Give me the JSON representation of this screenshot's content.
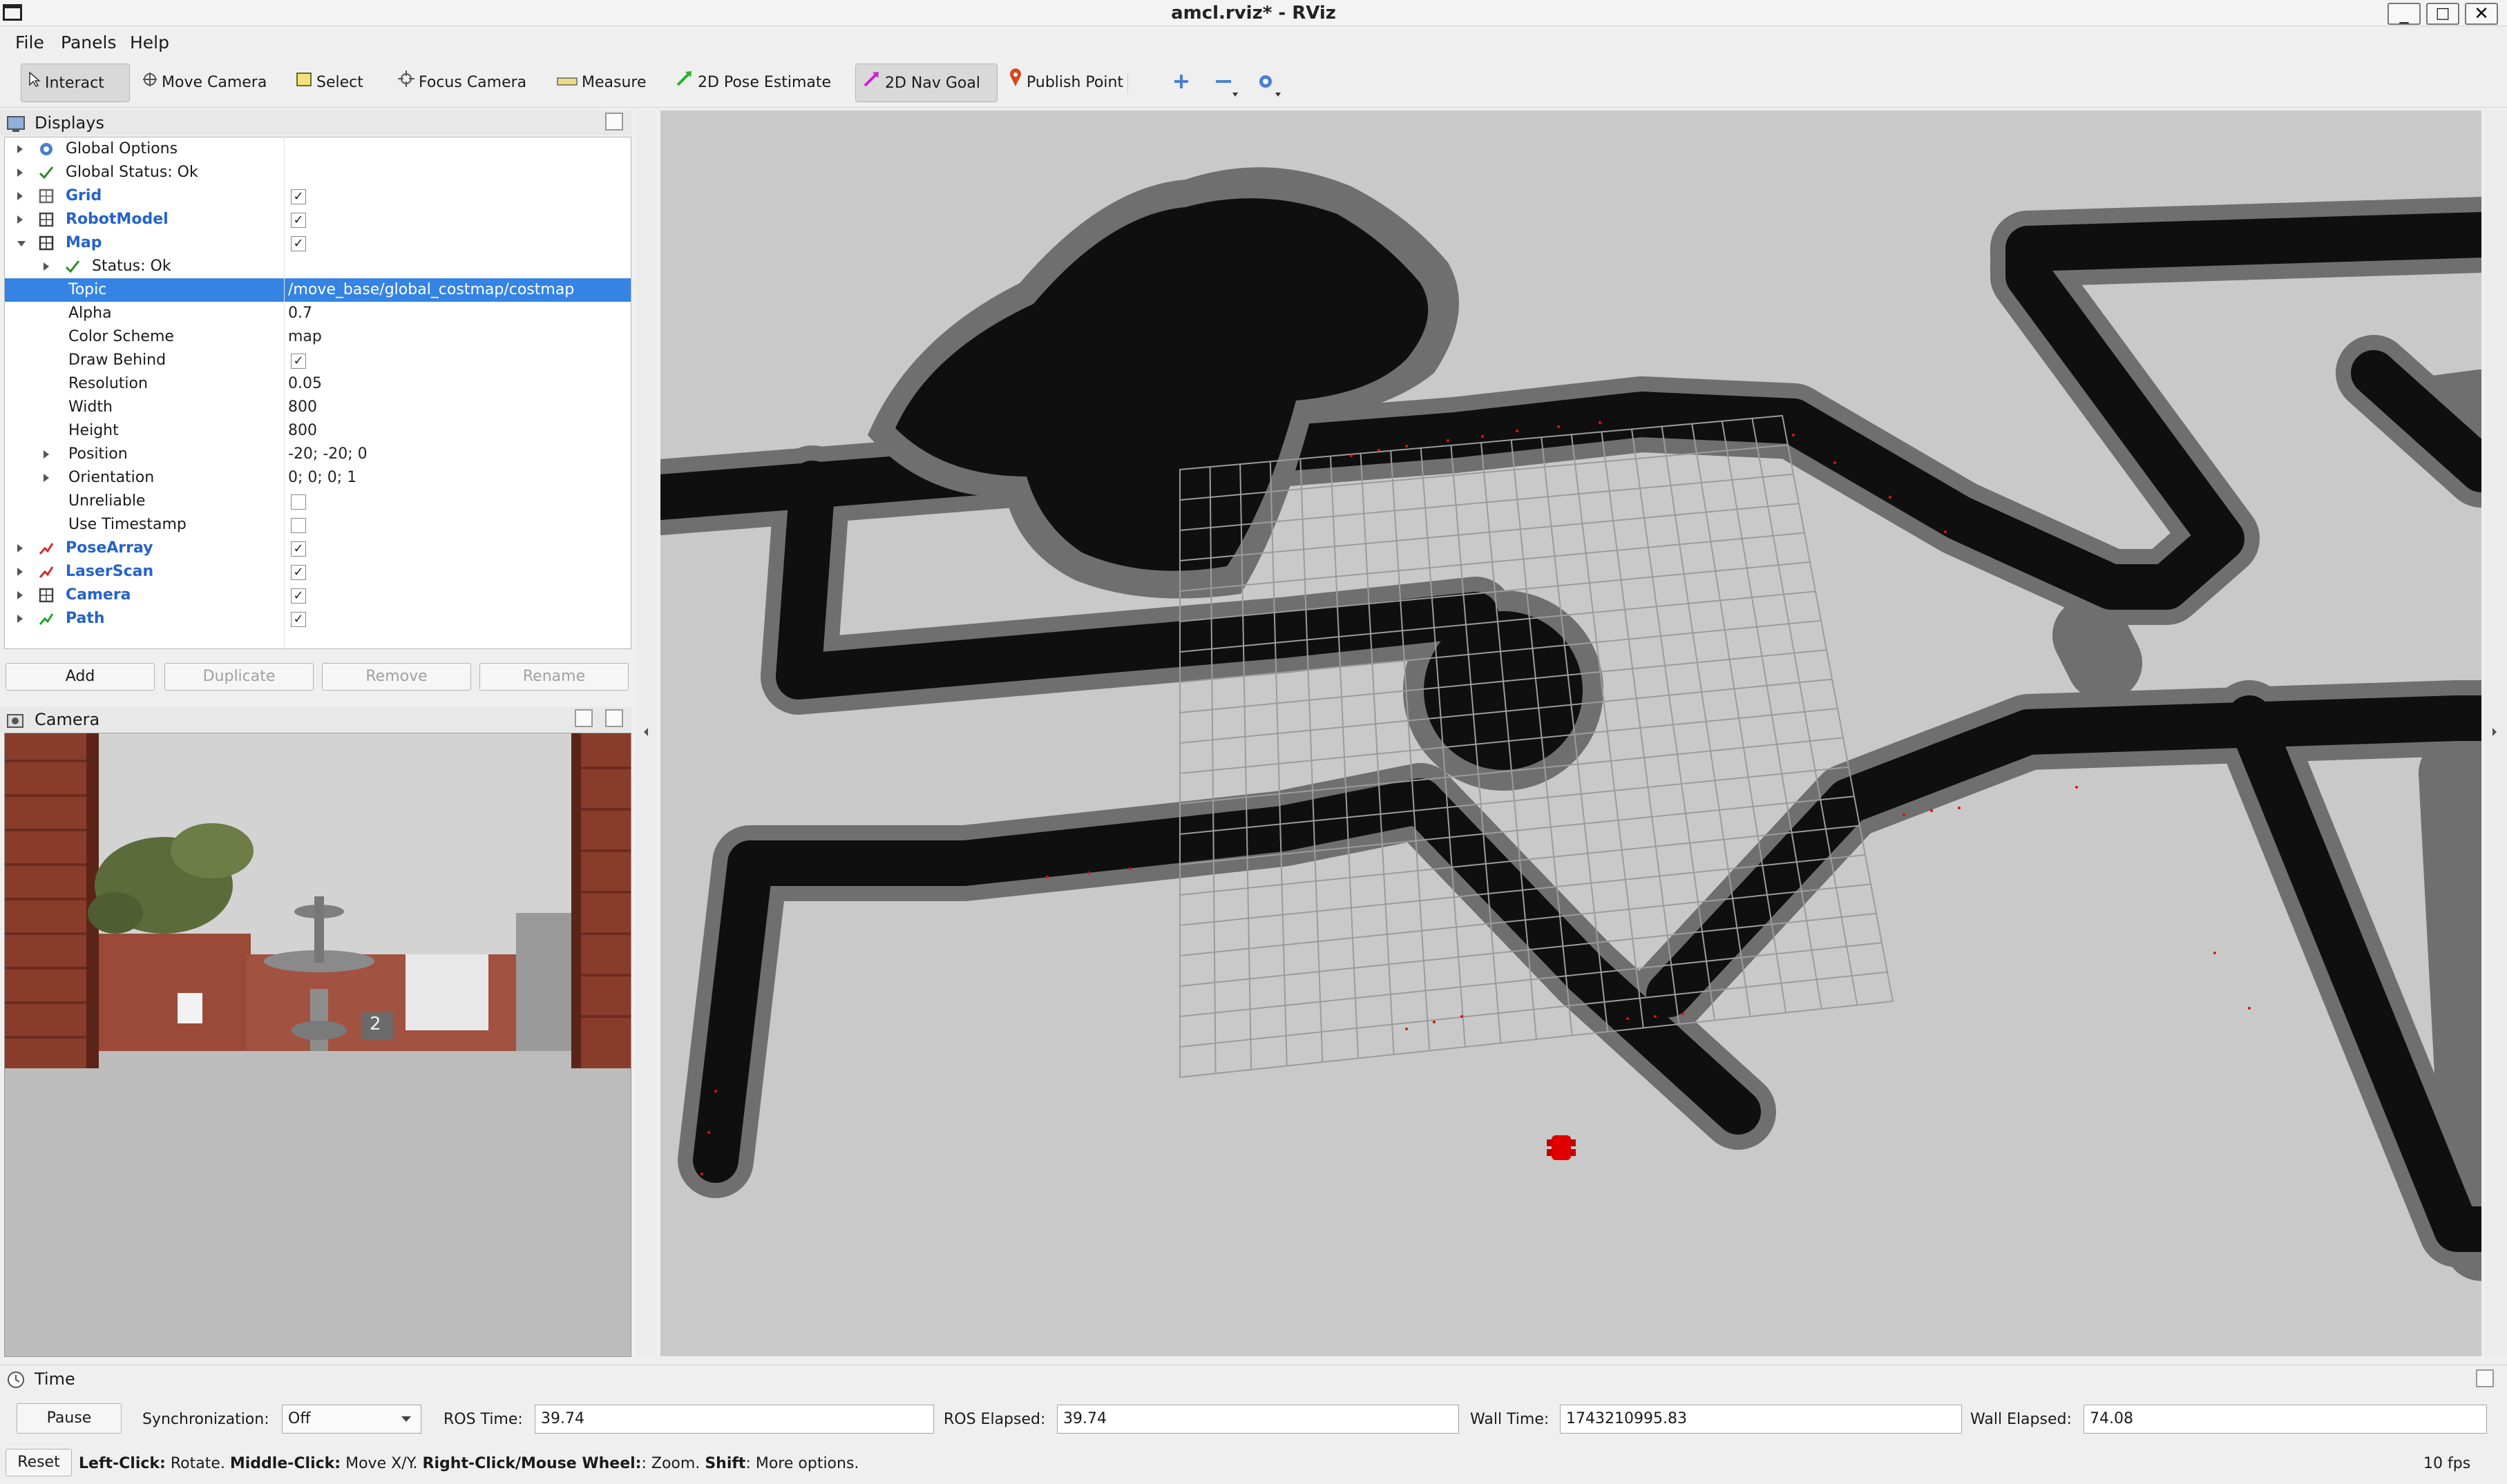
{
  "window": {
    "title": "amcl.rviz* - RViz",
    "controls": [
      "_",
      "□",
      "✕"
    ]
  },
  "menu": [
    "File",
    "Panels",
    "Help"
  ],
  "toolbar": {
    "tools": [
      {
        "label": "Interact",
        "active": true
      },
      {
        "label": "Move Camera"
      },
      {
        "label": "Select"
      },
      {
        "label": "Focus Camera"
      },
      {
        "label": "Measure"
      },
      {
        "label": "2D Pose Estimate"
      },
      {
        "label": "2D Nav Goal",
        "active": true
      },
      {
        "label": "Publish Point"
      }
    ],
    "extra_icons": [
      "plus-icon",
      "minus-icon",
      "camera-settings-icon"
    ]
  },
  "displays": {
    "title": "Displays",
    "rows": [
      {
        "label": "Global Options",
        "value": "",
        "icon": "gear-icon"
      },
      {
        "label": "Global Status: Ok",
        "value": "",
        "icon": "check-icon"
      },
      {
        "label": "Grid",
        "value": "",
        "checked": true,
        "icon": "grid-icon"
      },
      {
        "label": "RobotModel",
        "value": "",
        "checked": true,
        "icon": "robot-icon"
      },
      {
        "label": "Map",
        "value": "",
        "checked": true,
        "icon": "map-icon"
      },
      {
        "label": "Status: Ok",
        "value": "",
        "icon": "check-icon"
      },
      {
        "label": "Topic",
        "value": "/move_base/global_costmap/costmap"
      },
      {
        "label": "Alpha",
        "value": "0.7"
      },
      {
        "label": "Color Scheme",
        "value": "map"
      },
      {
        "label": "Draw Behind",
        "value": "",
        "checked": true
      },
      {
        "label": "Resolution",
        "value": "0.05"
      },
      {
        "label": "Width",
        "value": "800"
      },
      {
        "label": "Height",
        "value": "800"
      },
      {
        "label": "Position",
        "value": "-20; -20; 0"
      },
      {
        "label": "Orientation",
        "value": "0; 0; 0; 1"
      },
      {
        "label": "Unreliable",
        "value": "",
        "checked": false
      },
      {
        "label": "Use Timestamp",
        "value": "",
        "checked": false
      },
      {
        "label": "PoseArray",
        "value": "",
        "checked": true,
        "icon": "posearray-icon"
      },
      {
        "label": "LaserScan",
        "value": "",
        "checked": true,
        "icon": "laserscan-icon"
      },
      {
        "label": "Camera",
        "value": "",
        "checked": true,
        "icon": "camera-icon"
      },
      {
        "label": "Path",
        "value": "",
        "checked": true,
        "icon": "path-icon"
      }
    ],
    "buttons": {
      "add": "Add",
      "duplicate": "Duplicate",
      "remove": "Remove",
      "rename": "Rename"
    }
  },
  "camera_panel": {
    "title": "Camera",
    "marker_number": "2"
  },
  "time": {
    "title": "Time",
    "pause": "Pause",
    "sync_label": "Synchronization:",
    "sync_value": "Off",
    "ros_time_label": "ROS Time:",
    "ros_time": "39.74",
    "ros_elapsed_label": "ROS Elapsed:",
    "ros_elapsed": "39.74",
    "wall_time_label": "Wall Time:",
    "wall_time": "1743210995.83",
    "wall_elapsed_label": "Wall Elapsed:",
    "wall_elapsed": "74.08"
  },
  "status": {
    "reset": "Reset",
    "left_click": "Left-Click:",
    "left_click_desc": " Rotate. ",
    "middle_click": "Middle-Click:",
    "middle_click_desc": " Move X/Y. ",
    "right_click": "Right-Click/Mouse Wheel:",
    "right_click_desc": ": Zoom. ",
    "shift": "Shift",
    "shift_desc": ": More options.",
    "fps": "10 fps"
  },
  "colors": {
    "selection": "#3584e4",
    "bold_label": "#2563c9",
    "robot": "#e00000",
    "obstacle": "#0f0f0f"
  }
}
